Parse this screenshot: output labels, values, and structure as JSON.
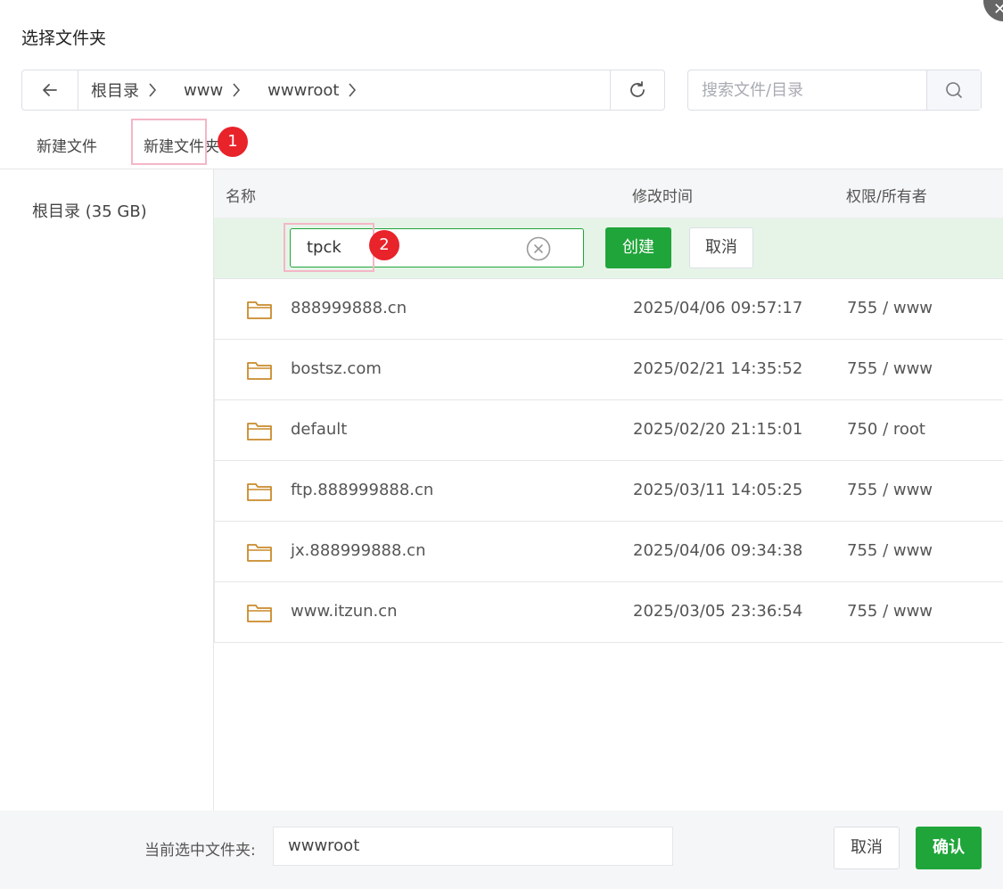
{
  "dialog": {
    "title": "选择文件夹"
  },
  "pathbar": {
    "crumbs": [
      {
        "label": "根目录"
      },
      {
        "label": "www"
      },
      {
        "label": "wwwroot"
      }
    ]
  },
  "search": {
    "placeholder": "搜索文件/目录"
  },
  "actions": {
    "new_file": "新建文件",
    "new_folder": "新建文件夹"
  },
  "annotations": {
    "badge1": "1",
    "badge2": "2"
  },
  "sidebar": {
    "items": [
      {
        "label": "根目录 (35 GB)"
      }
    ]
  },
  "table": {
    "headers": {
      "name": "名称",
      "mtime": "修改时间",
      "perm": "权限/所有者"
    },
    "new_row": {
      "value": "tpck",
      "create_label": "创建",
      "cancel_label": "取消"
    },
    "rows": [
      {
        "name": "888999888.cn",
        "mtime": "2025/04/06 09:57:17",
        "perm": "755 / www"
      },
      {
        "name": "bostsz.com",
        "mtime": "2025/02/21 14:35:52",
        "perm": "755 / www"
      },
      {
        "name": "default",
        "mtime": "2025/02/20 21:15:01",
        "perm": "750 / root"
      },
      {
        "name": "ftp.888999888.cn",
        "mtime": "2025/03/11 14:05:25",
        "perm": "755 / www"
      },
      {
        "name": "jx.888999888.cn",
        "mtime": "2025/04/06 09:34:38",
        "perm": "755 / www"
      },
      {
        "name": "www.itzun.cn",
        "mtime": "2025/03/05 23:36:54",
        "perm": "755 / www"
      }
    ]
  },
  "footer": {
    "label": "当前选中文件夹:",
    "value": "wwwroot",
    "cancel_label": "取消",
    "confirm_label": "确认"
  },
  "colors": {
    "primary": "#20a53a",
    "highlight": "#f4b6c6",
    "badge": "#e8232a",
    "folder": "#c98a2b"
  }
}
